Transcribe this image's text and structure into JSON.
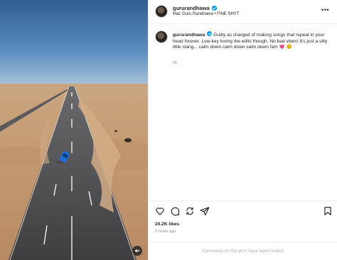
{
  "post": {
    "username": "gururandhawa",
    "audio": "Mac Guru Randhawa • FINE SHYT",
    "more_icon": "more-horizontal-icon",
    "verified_icon": "verified-badge-icon"
  },
  "caption": {
    "username": "gururandhawa",
    "text": "Guilty as charged of making songs that repeat in your head forever. Low-key loving the edits though. No bad vibes! It's just a silly little slang... calm down calm down calm down fam",
    "emojis": "💗 😊",
    "time": "3h"
  },
  "actions": {
    "icons": [
      "heart-icon",
      "comment-icon",
      "repost-icon",
      "share-icon",
      "save-bookmark-icon"
    ],
    "likes": "24.2K likes",
    "posted": "3 hours ago"
  },
  "footer": {
    "comments_limited": "Comments on this post have been limited."
  },
  "media": {
    "mute_icon": "mute-speaker-icon"
  },
  "colors": {
    "accent": "#0095f6",
    "sand": "#c9a27a",
    "sky": "#3d6f9e",
    "road": "#4a4a4c",
    "car": "#1f6fd6"
  }
}
